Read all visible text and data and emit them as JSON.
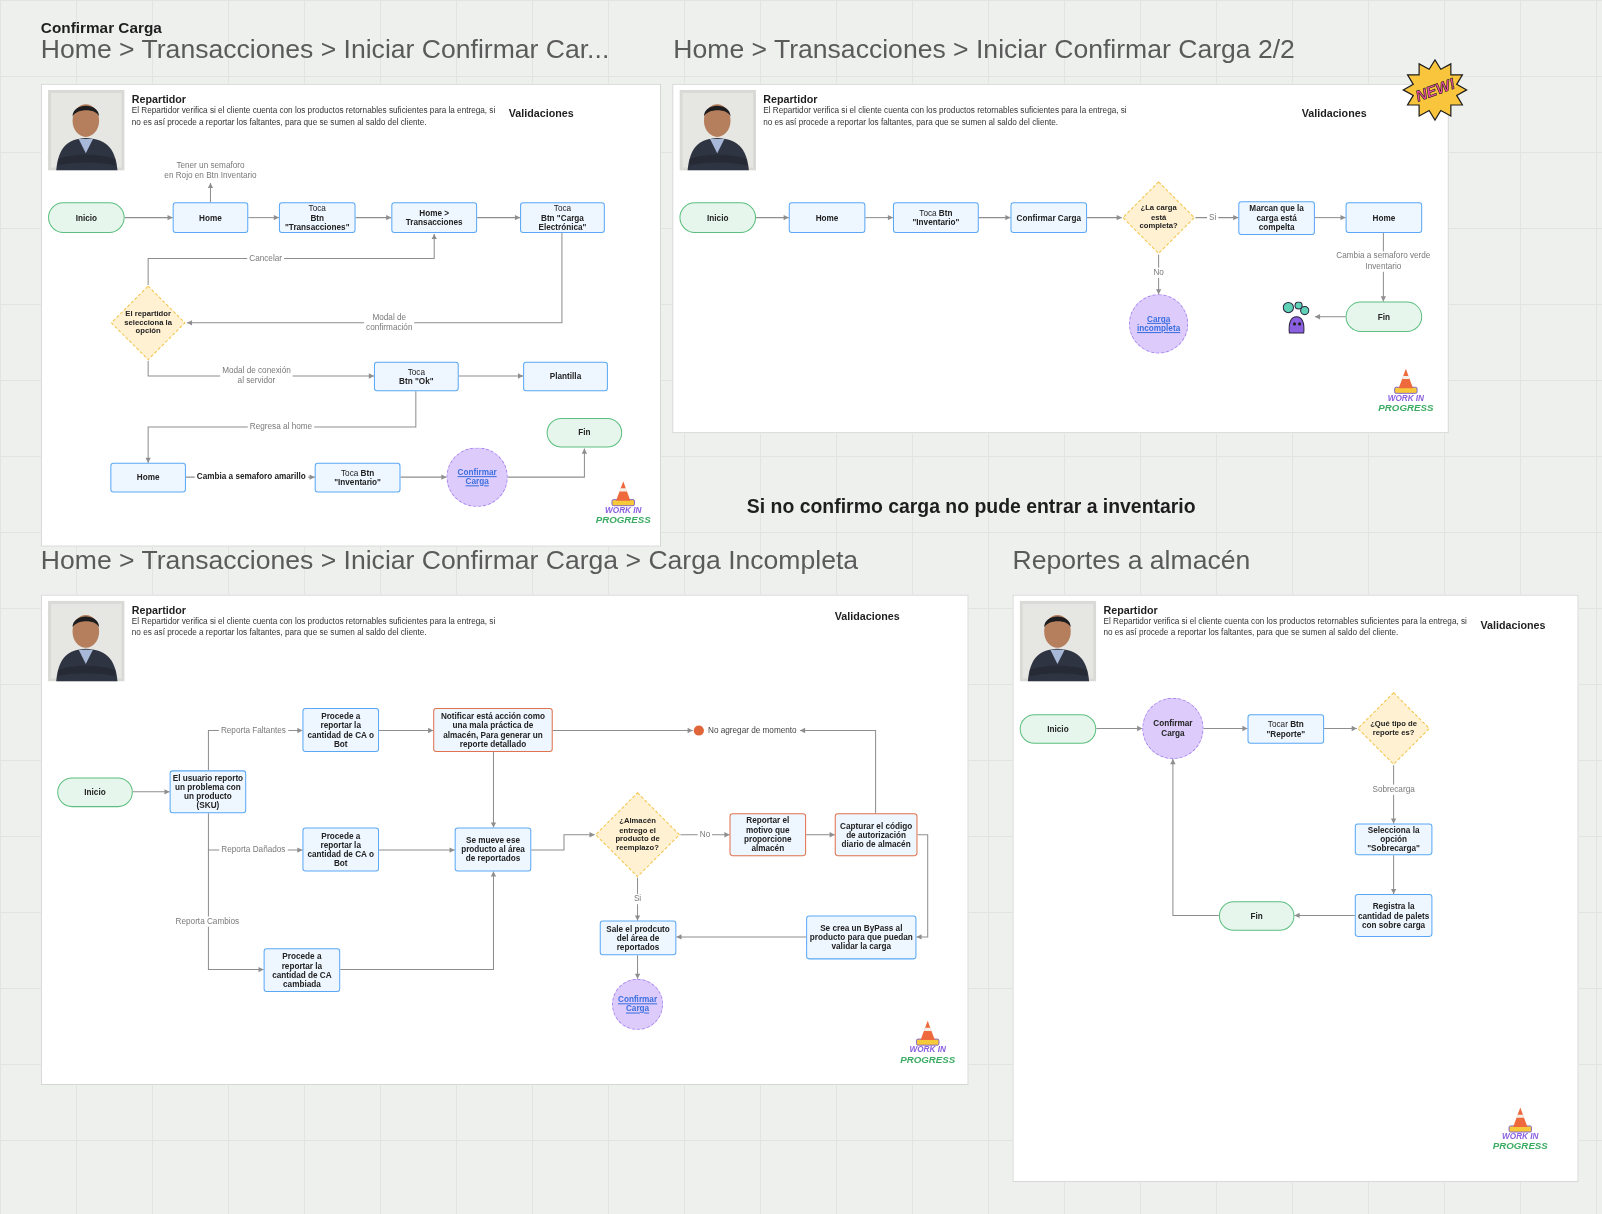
{
  "page_title": "Confirmar Carga",
  "annotation": "Si no confirmo carga no pude entrar a inventario",
  "frames": [
    {
      "breadcrumb": "Home > Transacciones > Iniciar Confirmar Car...",
      "header": {
        "role": "Repartidor",
        "description": "El Repartidor verifica si el cliente cuenta con los productos retornables suficientes para la entrega, si no es así procede a reportar los faltantes, para que se sumen al saldo del cliente.",
        "validations": "Validaciones"
      },
      "nodes": [
        {
          "kind": "terminal",
          "text": "Inicio"
        },
        {
          "kind": "process",
          "text": "Home"
        },
        {
          "kind": "tap",
          "text": "Toca\n**Btn \"Transacciones\"**"
        },
        {
          "kind": "process",
          "text": "Home > Transacciones"
        },
        {
          "kind": "tap",
          "text": "Toca\n**Btn \"Carga Electrónica\"**"
        },
        {
          "kind": "decision",
          "text": "El repartidor selecciona la opción"
        },
        {
          "kind": "tap",
          "text": "Toca\n**Btn \"Ok\"**"
        },
        {
          "kind": "process",
          "text": "Plantilla"
        },
        {
          "kind": "terminal",
          "text": "Fin"
        },
        {
          "kind": "process",
          "text": "Home"
        },
        {
          "kind": "tap",
          "text": "Toca **Btn \"Inventario\"**"
        },
        {
          "kind": "link_circle",
          "text": "Confirmar Carga"
        }
      ],
      "edge_labels": [
        {
          "text": "Tener un semaforo\nen Rojo en Btn Inventario",
          "strong": false
        },
        {
          "text": "Cancelar",
          "strong": false
        },
        {
          "text": "Modal de\nconfirmación",
          "strong": false
        },
        {
          "text": "Modal de conexión\nal servidor",
          "strong": false
        },
        {
          "text": "Regresa al home",
          "strong": false
        },
        {
          "text": "Cambia a semaforo amarillo",
          "strong": true
        }
      ],
      "sticker": "WORK IN\nPROGRESS"
    },
    {
      "breadcrumb": "Home > Transacciones > Iniciar Confirmar Carga 2/2",
      "badge": "NEW!",
      "header": {
        "role": "Repartidor",
        "description": "El Repartidor verifica si el cliente cuenta con los productos retornables suficientes para la entrega, si no es así procede a reportar los faltantes, para que se sumen al saldo del cliente.",
        "validations": "Validaciones"
      },
      "nodes": [
        {
          "kind": "terminal",
          "text": "Inicio"
        },
        {
          "kind": "process",
          "text": "Home"
        },
        {
          "kind": "tap",
          "text": "Toca **Btn \"Inventario\"**"
        },
        {
          "kind": "process",
          "text": "Confirmar Carga"
        },
        {
          "kind": "decision",
          "text": "¿La carga está completa?"
        },
        {
          "kind": "process",
          "text": "Marcan que la carga está compelta"
        },
        {
          "kind": "process",
          "text": "Home"
        },
        {
          "kind": "link_circle",
          "text": "Carga incompleta"
        },
        {
          "kind": "terminal",
          "text": "Fin"
        }
      ],
      "edge_labels": [
        {
          "text": "Si",
          "strong": false
        },
        {
          "text": "No",
          "strong": false
        },
        {
          "text": "Cambia a semaforo verde\nInventario",
          "strong": false
        }
      ],
      "sticker": "WORK IN\nPROGRESS"
    },
    {
      "breadcrumb": "Home > Transacciones > Iniciar Confirmar Carga > Carga Incompleta",
      "header": {
        "role": "Repartidor",
        "description": "El Repartidor verifica si el cliente cuenta con los productos retornables suficientes para la entrega, si no es así procede a reportar los faltantes, para que se sumen al saldo del cliente.",
        "validations": "Validaciones"
      },
      "nodes": [
        {
          "kind": "terminal",
          "text": "Inicio"
        },
        {
          "kind": "process",
          "text": "El usuario reporto un problema con un producto (SKU)"
        },
        {
          "kind": "process",
          "text": "Procede a reportar la cantidad de CA o Bot"
        },
        {
          "kind": "alert",
          "text": "Notificar está acción como una mala práctica de almacén, Para generar un reporte detallado"
        },
        {
          "kind": "process",
          "text": "Procede a reportar la cantidad de CA o Bot"
        },
        {
          "kind": "process",
          "text": "Se mueve ese producto al área de reportados"
        },
        {
          "kind": "process",
          "text": "Procede a reportar la cantidad de CA cambiada"
        },
        {
          "kind": "decision",
          "text": "¿Almacén entrego el producto de reemplazo?"
        },
        {
          "kind": "alert",
          "text": "Reportar el motivo que proporcione almacén"
        },
        {
          "kind": "alert",
          "text": "Capturar el código de autorización diario de almacén"
        },
        {
          "kind": "process",
          "text": "Sale el prodcuto del área de reportados"
        },
        {
          "kind": "process",
          "text": "Se crea un ByPass al producto para que puedan validar la carga"
        },
        {
          "kind": "link_circle",
          "text": "Confirmar Carga"
        },
        {
          "kind": "dot",
          "text": "No agregar de momento",
          "color": "#e0663a"
        }
      ],
      "edge_labels": [
        {
          "text": "Reporta Faltantes",
          "strong": false
        },
        {
          "text": "Reporta Dañados",
          "strong": false
        },
        {
          "text": "Reporta Cambios",
          "strong": false
        },
        {
          "text": "No",
          "strong": false
        },
        {
          "text": "Si",
          "strong": false
        }
      ],
      "sticker": "WORK IN\nPROGRESS"
    },
    {
      "breadcrumb": "Reportes a almacén",
      "header": {
        "role": "Repartidor",
        "description": "El Repartidor verifica si el cliente cuenta con los productos retornables suficientes para la entrega, si no es así procede a reportar los faltantes, para que se sumen al saldo del cliente.",
        "validations": "Validaciones"
      },
      "nodes": [
        {
          "kind": "terminal",
          "text": "Inicio"
        },
        {
          "kind": "circle",
          "text": "Confirmar Carga"
        },
        {
          "kind": "tap",
          "text": "Tocar **Btn \"Reporte\"**"
        },
        {
          "kind": "decision",
          "text": "¿Qué tipo de reporte es?"
        },
        {
          "kind": "process",
          "text": "Selecciona la opción \"Sobrecarga\""
        },
        {
          "kind": "terminal",
          "text": "Fin"
        },
        {
          "kind": "process",
          "text": "Registra la cantidad de palets con sobre carga"
        }
      ],
      "edge_labels": [
        {
          "text": "Sobrecarga",
          "strong": false
        }
      ],
      "sticker": "WORK IN\nPROGRESS"
    }
  ]
}
